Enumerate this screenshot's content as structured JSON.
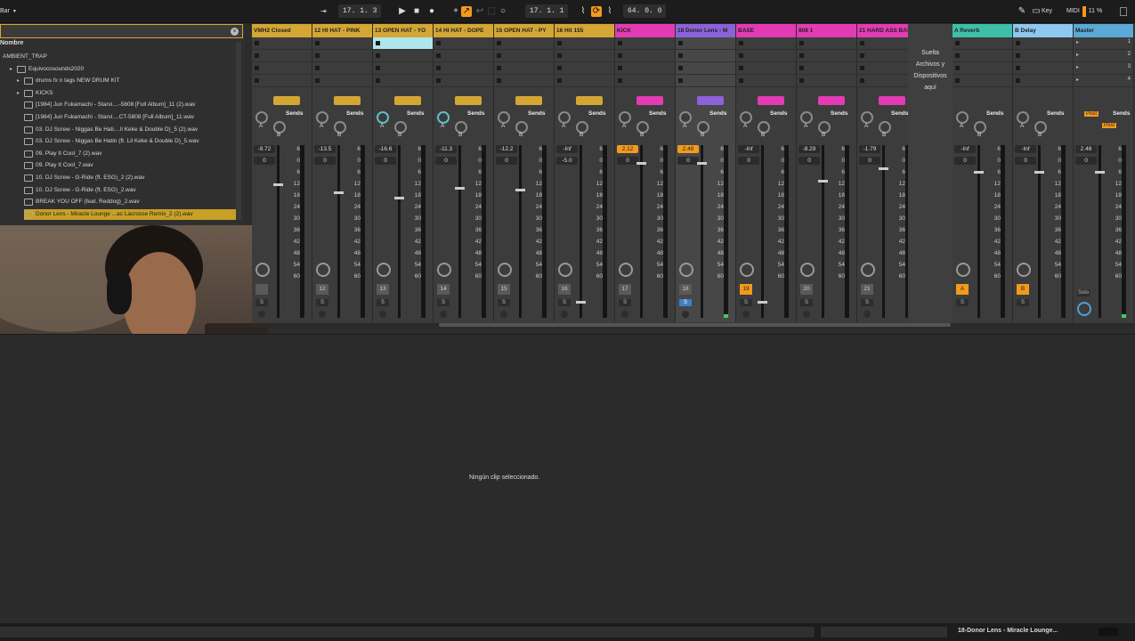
{
  "topbar": {
    "left_label": "Bar",
    "arrangement_position": "17.   1.   3",
    "loop_start": "17.   1.   1",
    "loop_length": "64.   0.   0",
    "key_label": "Key",
    "midi_label": "MIDI",
    "cpu_label": "11 %"
  },
  "browser": {
    "header": "Nombre",
    "items": [
      {
        "label": "AMBIENT_TRAP",
        "indent": 0,
        "type": "text"
      },
      {
        "label": "Equivocosounds2020",
        "indent": 1,
        "type": "folder"
      },
      {
        "label": "drums fx n tags NEW DRUM KIT",
        "indent": 2,
        "type": "folder"
      },
      {
        "label": "KICKS",
        "indent": 2,
        "type": "folder"
      },
      {
        "label": "[1984] Jun Fukamachi - Starvi....-5808 [Full Album]_11 (2).wav",
        "indent": 3,
        "type": "file"
      },
      {
        "label": "[1984] Jun Fukamachi - Starvi....CT-5808 [Full Album]_11.wav",
        "indent": 3,
        "type": "file"
      },
      {
        "label": "03. DJ Screw - Niggas Be Hati....ll Keke & Double D)_5 (2).wav",
        "indent": 3,
        "type": "file"
      },
      {
        "label": "03. DJ Screw - Niggas Be Hatin (ft. Lil Keke & Double D)_5.wav",
        "indent": 3,
        "type": "file"
      },
      {
        "label": "09. Play It Cool_7 (2).wav",
        "indent": 3,
        "type": "file"
      },
      {
        "label": "09. Play It Cool_7.wav",
        "indent": 3,
        "type": "file"
      },
      {
        "label": "10. DJ Screw - G-Ride (ft. ESG)_2 (2).wav",
        "indent": 3,
        "type": "file"
      },
      {
        "label": "10. DJ Screw - G-Ride (ft. ESG)_2.wav",
        "indent": 3,
        "type": "file"
      },
      {
        "label": "BREAK YOU OFF (feat. Reddog)_2.wav",
        "indent": 3,
        "type": "file"
      },
      {
        "label": "Donor Lens - Miracle Lounge ...ac Lacrosse Remix_2 (2).wav",
        "indent": 3,
        "type": "file",
        "selected": true
      }
    ]
  },
  "mixer": {
    "scale": [
      "6",
      "0",
      "6",
      "12",
      "18",
      "24",
      "30",
      "36",
      "42",
      "48",
      "54",
      "60"
    ],
    "sends_label": "Sends",
    "send_a": "A",
    "send_b": "B",
    "tracks": [
      {
        "name": "VMH2 Closed",
        "color": "#d4a634",
        "vol": "-9.72",
        "pan": "0",
        "num": "",
        "vol_orange": false,
        "fader": 0.78
      },
      {
        "name": "12 HI HAT - PINK",
        "color": "#d4a634",
        "vol": "-13.5",
        "pan": "0",
        "num": "12",
        "vol_orange": false,
        "fader": 0.73
      },
      {
        "name": "13 OPEN HAT - YO",
        "color": "#d4a634",
        "vol": "-16.6",
        "pan": "0",
        "num": "13",
        "vol_orange": false,
        "fader": 0.7,
        "lit_slot": true
      },
      {
        "name": "14 HI HAT - DOPE",
        "color": "#d4a634",
        "vol": "-11.3",
        "pan": "0",
        "num": "14",
        "vol_orange": false,
        "fader": 0.76
      },
      {
        "name": "15 OPEN HAT - PY",
        "color": "#d4a634",
        "vol": "-12.2",
        "pan": "0",
        "num": "15",
        "vol_orange": false,
        "fader": 0.75
      },
      {
        "name": "16 Hit 155",
        "color": "#d4a634",
        "vol": "-Inf",
        "pan": "-5.0",
        "num": "16",
        "vol_orange": false,
        "fader": 0.1
      },
      {
        "name": "KICK",
        "color": "#e23bb3",
        "vol": "2.12",
        "pan": "0",
        "num": "17",
        "vol_orange": true,
        "fader": 0.9
      },
      {
        "name": "18 Donor Lens - M",
        "color": "#8b62d9",
        "vol": "2.48",
        "pan": "0",
        "num": "18",
        "vol_orange": true,
        "fader": 0.9,
        "selected": true,
        "solo_blue": true
      },
      {
        "name": "BASE",
        "color": "#e23bb3",
        "vol": "-Inf",
        "pan": "0",
        "num": "19",
        "vol_orange": false,
        "fader": 0.1,
        "num_orange": true
      },
      {
        "name": "808 1",
        "color": "#e23bb3",
        "vol": "-8.29",
        "pan": "0",
        "num": "20",
        "vol_orange": false,
        "fader": 0.8
      },
      {
        "name": "21 HARD ASS BAS",
        "color": "#e23bb3",
        "vol": "-1.79",
        "pan": "0",
        "num": "21",
        "vol_orange": false,
        "fader": 0.87
      }
    ],
    "drop_area": [
      "Suelta",
      "Archivos y",
      "Dispositivos",
      "aquí"
    ],
    "returns": [
      {
        "name": "A Reverb",
        "color": "#3dbfa8",
        "vol": "-Inf",
        "pan": "0",
        "num": "A"
      },
      {
        "name": "B Delay",
        "color": "#8ec8ef",
        "vol": "-Inf",
        "pan": "0",
        "num": "B"
      }
    ],
    "master": {
      "name": "Master",
      "color": "#5aa9d6",
      "vol": "2.48",
      "pan": "0",
      "post": "Post",
      "solo_label": "Solo"
    }
  },
  "detail": {
    "message": "Ningún clip seleccionado."
  },
  "status": {
    "text": "18-Donor Lens - Miracle Lounge..."
  },
  "colors": {
    "accent": "#f39a1d",
    "selection": "#c7a026"
  }
}
